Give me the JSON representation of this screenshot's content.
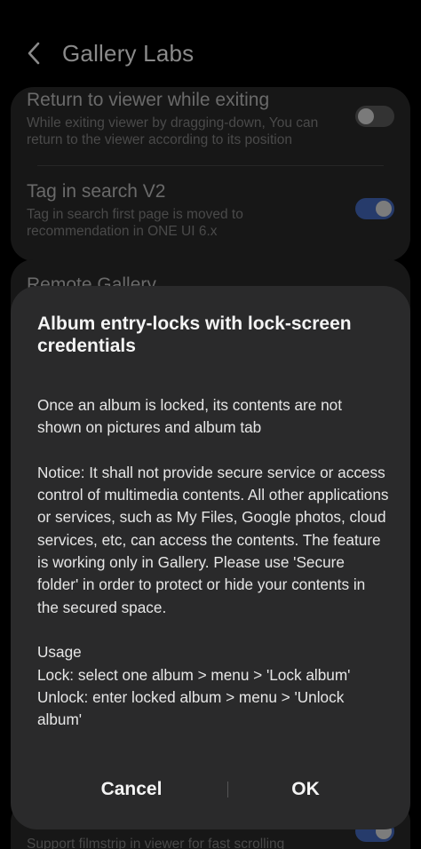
{
  "header": {
    "title": "Gallery Labs"
  },
  "settings": [
    {
      "title": "Return to viewer while exiting",
      "description": "While exiting viewer by dragging-down, You can return to the viewer according to its position",
      "enabled": false
    },
    {
      "title": "Tag in search V2",
      "description": "Tag in search first page is moved to recommendation in ONE UI 6.x",
      "enabled": true
    },
    {
      "title": "Remote Gallery"
    },
    {
      "description": "Support filmstrip in viewer for fast scrolling",
      "enabled": true
    }
  ],
  "dialog": {
    "title": "Album entry-locks with lock-screen credentials",
    "paragraph_1": "Once an album is locked, its contents are not shown on pictures and album tab",
    "paragraph_2": "Notice: It shall not provide secure service or access control of multimedia contents. All other applications or services, such as My Files, Google photos, cloud services, etc, can access the contents. The feature is working only in Gallery. Please use 'Secure folder' in order to protect or hide your contents in the secured space.",
    "usage_heading": "Usage",
    "usage_lock": "Lock: select one album > menu > 'Lock album'",
    "usage_unlock": "Unlock: enter locked album > menu > 'Unlock album'",
    "cancel_label": "Cancel",
    "ok_label": "OK"
  }
}
